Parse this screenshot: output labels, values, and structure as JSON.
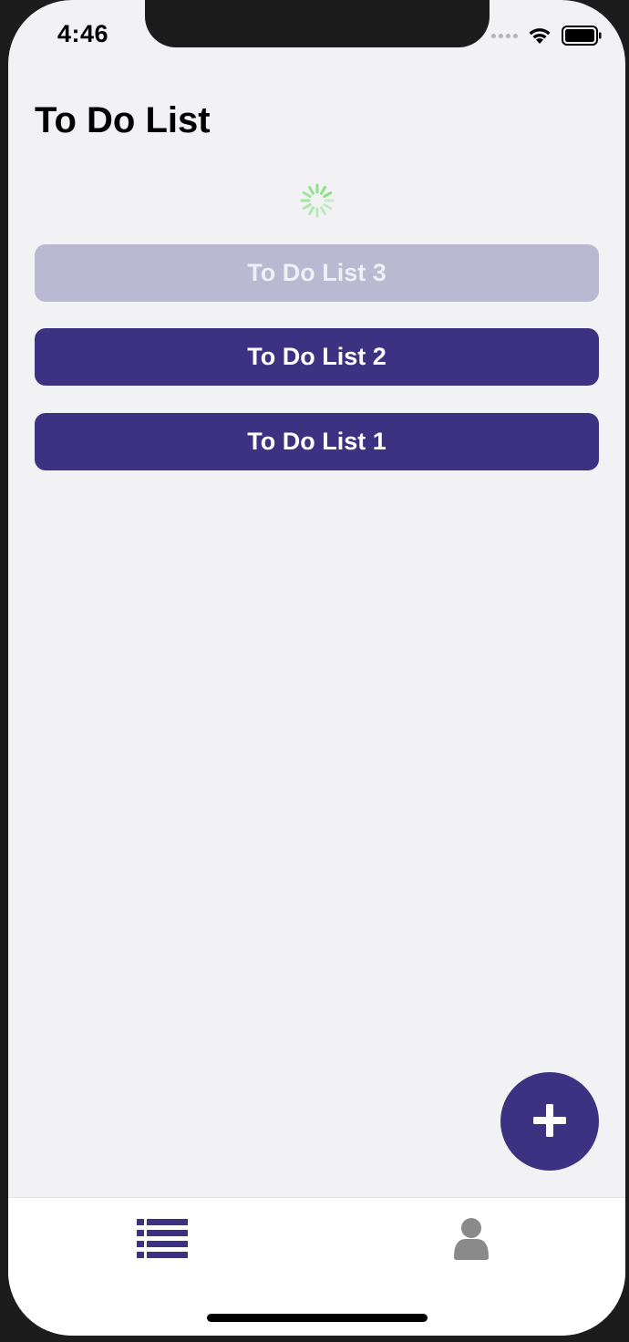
{
  "status_bar": {
    "time": "4:46",
    "signal_icon": "signal-dots-icon",
    "wifi_icon": "wifi-icon",
    "battery_icon": "battery-icon"
  },
  "header": {
    "title": "To Do List"
  },
  "loading": {
    "icon": "loading-spinner-icon",
    "color": "#7ee07a"
  },
  "lists": [
    {
      "label": "To Do List 3",
      "state": "disabled"
    },
    {
      "label": "To Do List 2",
      "state": "enabled"
    },
    {
      "label": "To Do List 1",
      "state": "enabled"
    }
  ],
  "fab": {
    "icon": "plus-icon"
  },
  "tab_bar": {
    "items": [
      {
        "name": "lists",
        "icon": "list-icon",
        "active": true
      },
      {
        "name": "profile",
        "icon": "user-icon",
        "active": false
      }
    ]
  },
  "colors": {
    "accent": "#3d3281",
    "disabled": "#bbb8d1",
    "background": "#f2f2f4",
    "inactive_tab": "#8a8a8a"
  }
}
